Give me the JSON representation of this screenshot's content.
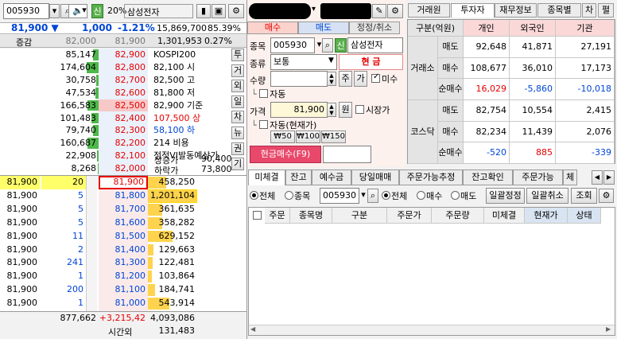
{
  "left": {
    "code": "005930",
    "credit_badge": "신",
    "margin_rate": "20%",
    "stock_name": "삼성전자",
    "price": "81,900",
    "change": "1,000",
    "change_pct": "-1.21%",
    "volume": "15,869,700",
    "volume_ratio": "85.39%",
    "header_label": "증감",
    "header_ask_price": "82,000",
    "header_bid_price": "81,900",
    "header_volume": "1,301,953",
    "header_volume_pct": "0.27%",
    "ask_rows": [
      {
        "qty": "85,147",
        "price": "82,900",
        "info": "KOSPI200"
      },
      {
        "qty": "174,604",
        "price": "82,800",
        "info": "82,100 시"
      },
      {
        "qty": "30,758",
        "price": "82,700",
        "info": "82,500 고"
      },
      {
        "qty": "47,534",
        "price": "82,600",
        "info": "81,800 저"
      },
      {
        "qty": "166,583",
        "price": "82,500",
        "info": "82,900 기준"
      },
      {
        "qty": "101,483",
        "price": "82,400",
        "info": "107,500 상"
      },
      {
        "qty": "79,740",
        "price": "82,300",
        "info": "58,100 하"
      },
      {
        "qty": "160,687",
        "price": "82,200",
        "info": "214 비용"
      },
      {
        "qty": "22,908",
        "price": "82,100",
        "info": "정적VI발동예상가"
      },
      {
        "qty": "8,268",
        "price": "82,000",
        "info": ""
      }
    ],
    "vi_up_label": "상승가",
    "vi_up_value": "90,400",
    "vi_down_label": "하락가",
    "vi_down_value": "73,800",
    "side_buttons": [
      "투",
      "거",
      "외",
      "일",
      "차",
      "뉴",
      "권",
      "기"
    ],
    "ticks": [
      {
        "price": "81,900",
        "qty": "20"
      },
      {
        "price": "81,900",
        "qty": "5"
      },
      {
        "price": "81,900",
        "qty": "5"
      },
      {
        "price": "81,900",
        "qty": "5"
      },
      {
        "price": "81,900",
        "qty": "11"
      },
      {
        "price": "81,900",
        "qty": "2"
      },
      {
        "price": "81,900",
        "qty": "241"
      },
      {
        "price": "81,900",
        "qty": "1"
      },
      {
        "price": "81,900",
        "qty": "200"
      },
      {
        "price": "81,900",
        "qty": "1"
      }
    ],
    "bid_rows": [
      {
        "price": "81,900",
        "qty": "458,250"
      },
      {
        "price": "81,800",
        "qty": "1,201,104"
      },
      {
        "price": "81,700",
        "qty": "361,635"
      },
      {
        "price": "81,600",
        "qty": "358,282"
      },
      {
        "price": "81,500",
        "qty": "629,152"
      },
      {
        "price": "81,400",
        "qty": "129,663"
      },
      {
        "price": "81,300",
        "qty": "122,481"
      },
      {
        "price": "81,200",
        "qty": "103,864"
      },
      {
        "price": "81,100",
        "qty": "184,741"
      },
      {
        "price": "81,000",
        "qty": "543,914"
      }
    ],
    "total_ask": "877,662",
    "total_diff": "+3,215,42",
    "total_bid": "4,093,086",
    "after_label": "시간외",
    "after_value": "131,483"
  },
  "order": {
    "account_masked": "",
    "tabs": [
      "매수",
      "매도",
      "정정/취소"
    ],
    "code_label": "종목",
    "code": "005930",
    "credit_badge": "신",
    "stock_name": "삼성전자",
    "type_label": "종류",
    "type_value": "보통",
    "cash_label": "현  금",
    "qty_label": "수량",
    "qty_value": "",
    "ju_button": "주",
    "ga_button": "가",
    "misu_label": "미수",
    "auto1_label": "자동",
    "price_label": "가격",
    "price_value": "81,900",
    "won_button": "원",
    "market_label": "시장가",
    "auto2_label": "자동(현재가)",
    "quick_buttons": [
      "₩50",
      "₩100",
      "₩150"
    ],
    "submit_label": "현금매수(F9)"
  },
  "investor": {
    "tabs": [
      "거래원",
      "투자자",
      "재무정보",
      "종목별",
      "차",
      "펼"
    ],
    "headers": [
      "구분(억원)",
      "개인",
      "외국인",
      "기관"
    ],
    "groups": [
      {
        "name": "거래소",
        "rows": [
          {
            "label": "매도",
            "values": [
              "92,648",
              "41,871",
              "27,191"
            ]
          },
          {
            "label": "매수",
            "values": [
              "108,677",
              "36,010",
              "17,173"
            ]
          },
          {
            "label": "순매수",
            "values": [
              "16,029",
              "-5,860",
              "-10,018"
            ]
          }
        ]
      },
      {
        "name": "코스닥",
        "rows": [
          {
            "label": "매도",
            "values": [
              "82,754",
              "10,554",
              "2,415"
            ]
          },
          {
            "label": "매수",
            "values": [
              "82,234",
              "11,439",
              "2,076"
            ]
          },
          {
            "label": "순매수",
            "values": [
              "-520",
              "885",
              "-339"
            ]
          }
        ]
      }
    ]
  },
  "bottom": {
    "tabs": [
      "미체결",
      "잔고",
      "예수금",
      "당일매매",
      "주문가능추정",
      "잔고확인",
      "주문가능",
      "체"
    ],
    "filter_all": "전체",
    "filter_stock": "종목",
    "filter_code": "005930",
    "side_all": "전체",
    "side_buy": "매수",
    "side_sell": "매도",
    "btn_modify_all": "일괄정정",
    "btn_cancel_all": "일괄취소",
    "btn_query": "조회",
    "columns": [
      "주문",
      "종목명",
      "구분",
      "주문가",
      "주문량",
      "미체결",
      "현재가",
      "상태"
    ]
  }
}
